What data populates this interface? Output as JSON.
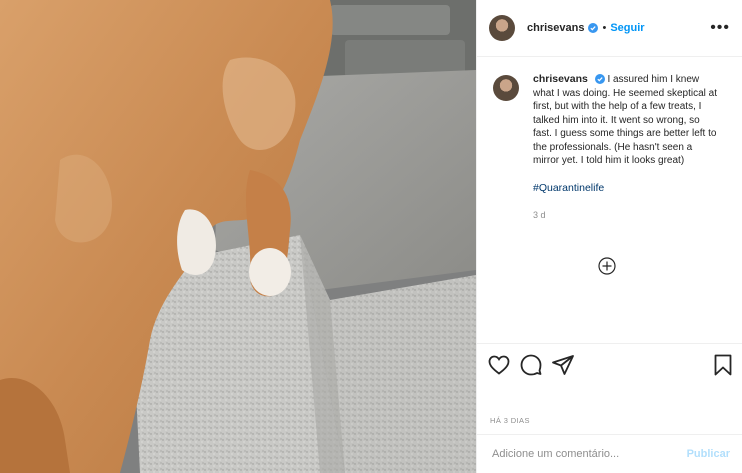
{
  "post": {
    "author": "chrisevans",
    "follow_label": "Seguir",
    "dot": "•",
    "more_label": "•••",
    "caption": "I assured him I knew what I was doing. He seemed skeptical at first, but with the help of a few treats, I talked him into it. It went so wrong, so fast. I guess some things are better left to the professionals. (He hasn't seen a mirror yet. I told him it looks great)",
    "hashtag": "#Quarantinelife",
    "relative_time": "3 d",
    "date_label": "HÁ 3 DIAS",
    "comment_placeholder": "Adicione um comentário...",
    "publish_label": "Publicar"
  },
  "icons": {
    "verified": "verified-badge-icon",
    "load_more": "plus-circle-icon",
    "like": "heart-icon",
    "comment": "comment-bubble-icon",
    "share": "paper-plane-icon",
    "save": "bookmark-icon"
  },
  "colors": {
    "accent": "#0095f6",
    "verified": "#3897f0",
    "muted": "#8e8e8e",
    "publish_disabled": "#b2dffc",
    "hashtag": "#00376b"
  }
}
